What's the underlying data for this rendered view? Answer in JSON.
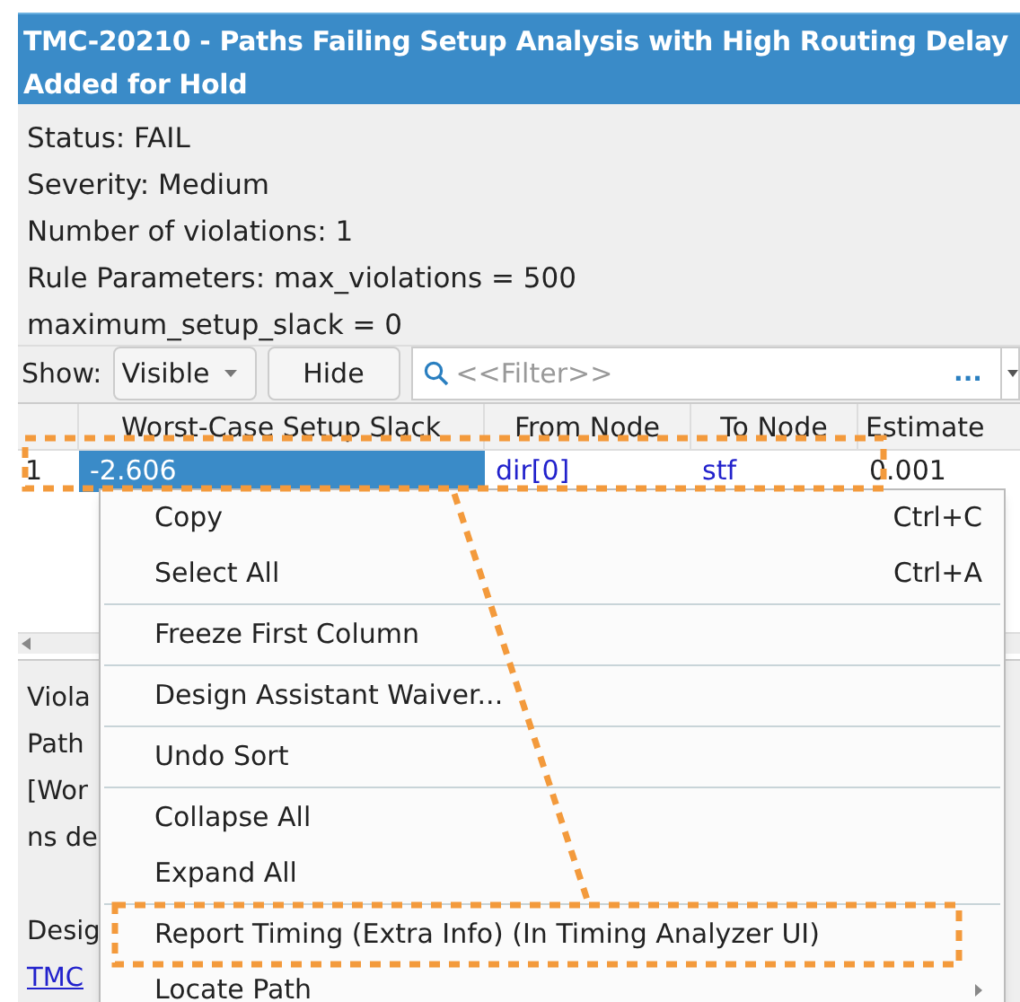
{
  "window": {
    "title": "TMC-20210 - Paths Failing Setup Analysis with High Routing Delay Added for Hold"
  },
  "info_lines": [
    "Status: FAIL",
    "Severity: Medium",
    "Number of violations: 1",
    "Rule Parameters: max_violations = 500",
    "maximum_setup_slack = 0"
  ],
  "toolbar": {
    "show_label": "Show:",
    "show_dropdown": {
      "value": "Visible"
    },
    "hide_button": "Hide",
    "filter": {
      "placeholder": "<<Filter>>",
      "more_button": "..."
    }
  },
  "table": {
    "columns": [
      "Worst-Case Setup Slack",
      "From Node",
      "To Node",
      "Estimate"
    ],
    "rows": [
      {
        "number": "1",
        "annotated": true,
        "cells": [
          {
            "text": "-2.606",
            "kind": "value",
            "selected": true
          },
          {
            "text": "dir[0]",
            "kind": "link",
            "selected": false
          },
          {
            "text": "stf",
            "kind": "link",
            "selected": false
          },
          {
            "text": "0.001",
            "kind": "value",
            "selected": false
          }
        ]
      }
    ]
  },
  "details_paragraphs": [
    [
      {
        "text": "Viola",
        "kind": "text"
      },
      {
        "text": "Path",
        "kind": "text"
      },
      {
        "text": "[Wor",
        "kind": "text"
      },
      {
        "text": "ns de",
        "kind": "text"
      }
    ],
    [
      {
        "text": "Desig",
        "kind": "text"
      },
      {
        "text": "TMC",
        "kind": "link"
      }
    ]
  ],
  "context_menu": {
    "items": [
      {
        "kind": "item",
        "label": "Copy",
        "shortcut": "Ctrl+C",
        "submenu": false,
        "annotated": false
      },
      {
        "kind": "item",
        "label": "Select All",
        "shortcut": "Ctrl+A",
        "submenu": false,
        "annotated": false
      },
      {
        "kind": "separator"
      },
      {
        "kind": "item",
        "label": "Freeze First Column",
        "submenu": false,
        "annotated": false
      },
      {
        "kind": "separator"
      },
      {
        "kind": "item",
        "label": "Design Assistant Waiver...",
        "submenu": false,
        "annotated": false
      },
      {
        "kind": "separator"
      },
      {
        "kind": "item",
        "label": "Undo Sort",
        "submenu": false,
        "annotated": false
      },
      {
        "kind": "separator"
      },
      {
        "kind": "item",
        "label": "Collapse All",
        "submenu": false,
        "annotated": false
      },
      {
        "kind": "item",
        "label": "Expand All",
        "submenu": false,
        "annotated": false
      },
      {
        "kind": "separator"
      },
      {
        "kind": "item",
        "label": "Report Timing (Extra Info) (In Timing Analyzer UI)",
        "submenu": false,
        "annotated": true
      },
      {
        "kind": "item",
        "label": "Locate Path",
        "submenu": true,
        "annotated": false
      }
    ]
  }
}
